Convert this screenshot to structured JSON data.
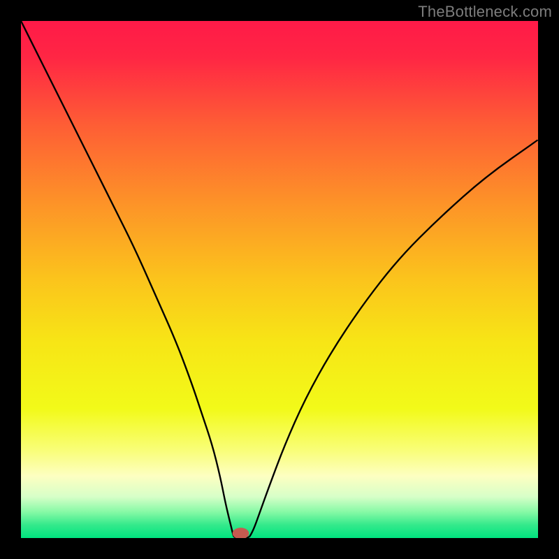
{
  "watermark": "TheBottleneck.com",
  "chart_data": {
    "type": "line",
    "title": "",
    "xlabel": "",
    "ylabel": "",
    "xlim": [
      0,
      100
    ],
    "ylim": [
      0,
      100
    ],
    "background_gradient": {
      "stops": [
        {
          "offset": 0.0,
          "color": "#ff1a48"
        },
        {
          "offset": 0.07,
          "color": "#ff2644"
        },
        {
          "offset": 0.2,
          "color": "#fe5d35"
        },
        {
          "offset": 0.35,
          "color": "#fd9228"
        },
        {
          "offset": 0.5,
          "color": "#fbc41c"
        },
        {
          "offset": 0.62,
          "color": "#f7e516"
        },
        {
          "offset": 0.75,
          "color": "#f2fa19"
        },
        {
          "offset": 0.83,
          "color": "#f9fe78"
        },
        {
          "offset": 0.88,
          "color": "#fdffc1"
        },
        {
          "offset": 0.92,
          "color": "#d7ffc8"
        },
        {
          "offset": 0.95,
          "color": "#85f9a5"
        },
        {
          "offset": 0.975,
          "color": "#33e98b"
        },
        {
          "offset": 1.0,
          "color": "#00e47f"
        }
      ]
    },
    "series": [
      {
        "name": "bottleneck-curve",
        "color": "#000000",
        "x": [
          0,
          3,
          6,
          10,
          14,
          18,
          22,
          26,
          30,
          33,
          35,
          37,
          38.5,
          39.5,
          40.2,
          40.7,
          41.0,
          41.3,
          44.0,
          44.5,
          45.2,
          46.2,
          48,
          51,
          55,
          60,
          66,
          73,
          81,
          90,
          100
        ],
        "y": [
          100,
          94,
          88,
          80,
          72,
          64,
          56,
          47,
          38,
          30,
          24,
          18,
          12,
          7,
          4,
          2,
          0.7,
          0,
          0,
          0.7,
          2.2,
          5,
          10,
          18,
          27,
          36,
          45,
          54,
          62,
          70,
          77
        ]
      }
    ],
    "marker": {
      "name": "sweet-spot",
      "x": 42.5,
      "y": 0.9,
      "rx": 1.6,
      "ry": 1.1,
      "fill": "#c65a50"
    }
  }
}
